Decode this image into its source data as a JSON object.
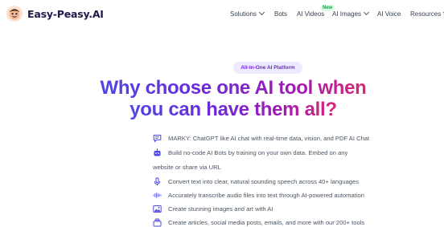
{
  "brand": {
    "name": "Easy-Peasy.AI"
  },
  "nav": {
    "items": [
      {
        "label": "Solutions",
        "dropdown": true
      },
      {
        "label": "Bots",
        "dropdown": false
      },
      {
        "label": "AI Videos",
        "dropdown": false
      },
      {
        "label": "AI Images",
        "dropdown": true,
        "badge": "New"
      },
      {
        "label": "AI Voice",
        "dropdown": false
      },
      {
        "label": "Resources",
        "dropdown": true
      }
    ]
  },
  "hero": {
    "pill": "All-In-One AI Platform",
    "headline_line1": "Why choose one AI tool when",
    "headline_line2": "you can have them all?"
  },
  "features": [
    {
      "icon": "chat-bubble-icon",
      "text": "MARKY: ChatGPT like AI chat with real-time data, vision, and PDF AI Chat"
    },
    {
      "icon": "robot-icon",
      "text": "Build no-code AI Bots by training on your own data. Embed on any",
      "continuation": "website or share via URL"
    },
    {
      "icon": "microphone-icon",
      "text": "Convert text into clear, natural sounding speech across 40+ languages"
    },
    {
      "icon": "waveform-icon",
      "text": "Accurately transcribe audio files into text through AI-powered automation"
    },
    {
      "icon": "image-icon",
      "text": "Create stunning images and art with AI"
    },
    {
      "icon": "document-stack-icon",
      "text": "Create articles, social media posts, emails, and more with our 200+ tools"
    }
  ],
  "colors": {
    "accent": "#6d28d9",
    "icon": "#4f46e5",
    "gradient_start": "#4f46e5",
    "gradient_end": "#db2777",
    "new_badge": "#16a34a"
  }
}
